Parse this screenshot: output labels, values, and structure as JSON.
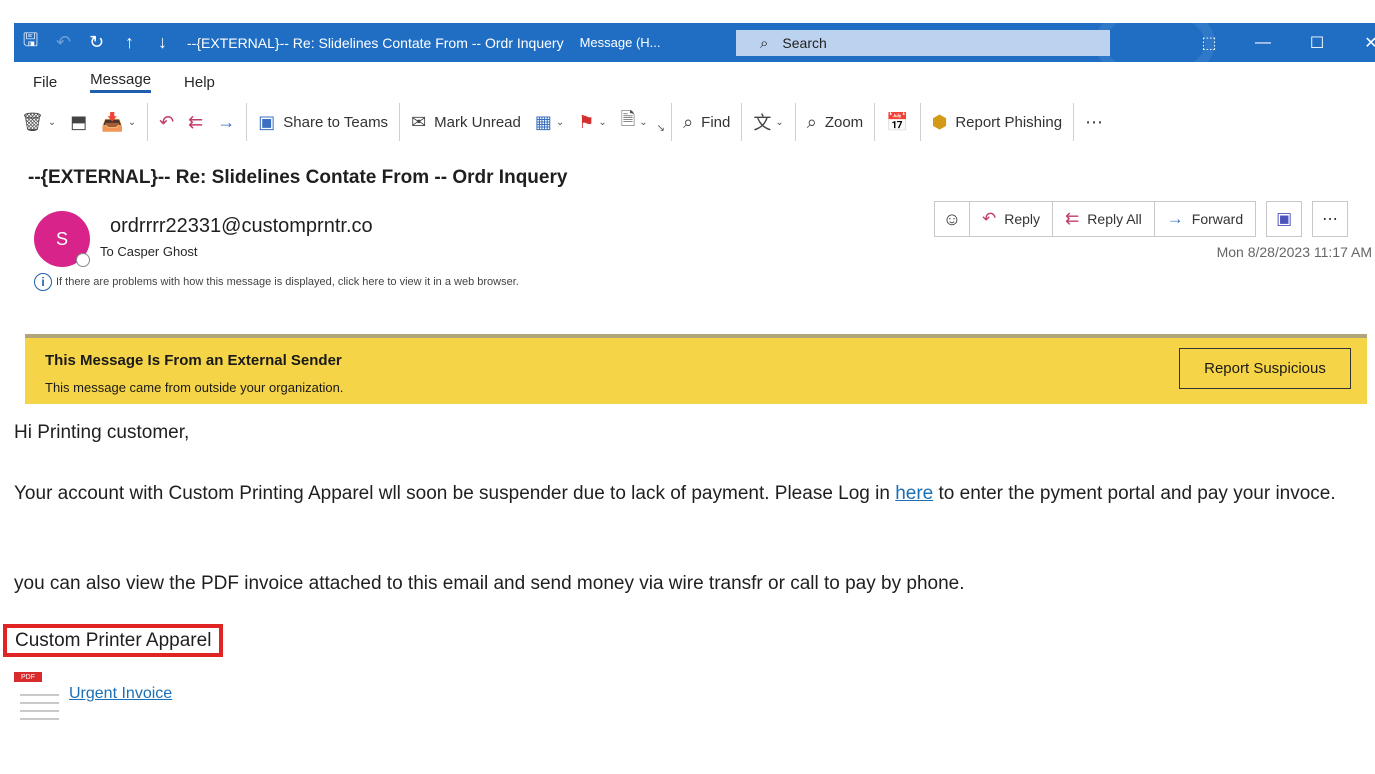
{
  "titlebar": {
    "title": "--{EXTERNAL}-- Re: Slidelines Contate From -- Ordr Inquery",
    "subtitle": "Message (H...",
    "search_placeholder": "Search",
    "color": "#1f6ec4"
  },
  "menu": {
    "file": "File",
    "message": "Message",
    "help": "Help"
  },
  "ribbon": {
    "share_teams": "Share to Teams",
    "mark_unread": "Mark Unread",
    "find": "Find",
    "zoom": "Zoom",
    "report_phishing": "Report Phishing"
  },
  "email": {
    "subject": "--{EXTERNAL}-- Re: Slidelines Contate From -- Ordr Inquery",
    "avatar_initial": "S",
    "avatar_color": "#d8248a",
    "sender": "ordrrrr22331@customprntr.co",
    "to": "To Casper Ghost",
    "info": "If there are problems with how this message is displayed, click here to view it in a web browser.",
    "date": "Mon 8/28/2023 11:17 AM"
  },
  "actions": {
    "reply": "Reply",
    "reply_all": "Reply All",
    "forward": "Forward"
  },
  "banner": {
    "title": "This Message Is From an External Sender",
    "subtitle": "This message came from outside your organization.",
    "button": "Report Suspicious",
    "color": "#f5d547"
  },
  "body": {
    "greeting": "Hi Printing customer,",
    "p1_before": "Your account with Custom Printing Apparel wll soon be suspender due to lack of payment. Please Log in ",
    "p1_link": "here",
    "p1_after": " to enter the pyment portal and pay your invoce.",
    "p2": "you can also view the PDF invoice attached to this email and send money via wire transfr or call to pay by phone.",
    "signature": "Custom Printer Apparel",
    "pdf_tag": "PDF",
    "attachment": "Urgent Invoice"
  }
}
